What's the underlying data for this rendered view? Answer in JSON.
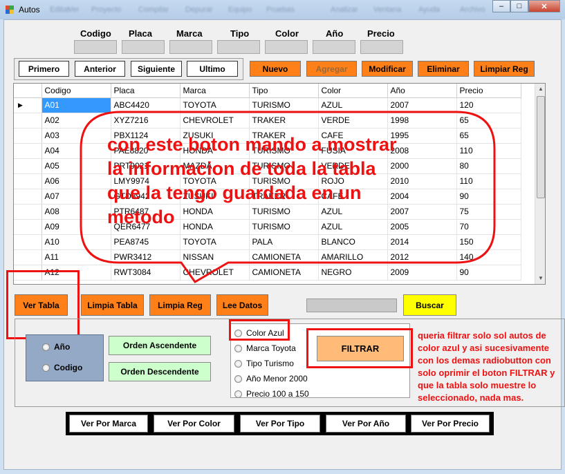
{
  "window": {
    "title": "Autos",
    "menu_blur": [
      "Archivo",
      "Editar",
      "Ver",
      "Proyecto",
      "Compilar",
      "Depurar",
      "Equipo",
      "Herramientas",
      "Pruebas",
      "Analizar",
      "Ventana",
      "Ayuda"
    ],
    "min": "–",
    "max": "□",
    "close": "✕"
  },
  "fields": {
    "headers": [
      "Codigo",
      "Placa",
      "Marca",
      "Tipo",
      "Color",
      "Año",
      "Precio"
    ]
  },
  "nav": {
    "first": "Primero",
    "prev": "Anterior",
    "next": "Siguiente",
    "last": "Ultimo"
  },
  "actions": {
    "nuevo": "Nuevo",
    "agregar": "Agregar",
    "modificar": "Modificar",
    "eliminar": "Eliminar",
    "limpiar": "Limpiar Reg"
  },
  "grid": {
    "columns": [
      "Codigo",
      "Placa",
      "Marca",
      "Tipo",
      "Color",
      "Año",
      "Precio"
    ],
    "rows": [
      [
        "A01",
        "ABC4420",
        "TOYOTA",
        "TURISMO",
        "AZUL",
        "2007",
        "120"
      ],
      [
        "A02",
        "XYZ7216",
        "CHEVROLET",
        "TRAKER",
        "VERDE",
        "1998",
        "65"
      ],
      [
        "A03",
        "PBX1124",
        "ZUSUKI",
        "TRAKER",
        "CAFE",
        "1995",
        "65"
      ],
      [
        "A04",
        "PAE8820",
        "HONDA",
        "TURISMO",
        "FUSIA",
        "2008",
        "110"
      ],
      [
        "A05",
        "PRT9021",
        "MAZDA",
        "TURISMO",
        "VERDE",
        "2000",
        "80"
      ],
      [
        "A06",
        "LMY9974",
        "TOYOTA",
        "TURISMO",
        "ROJO",
        "2010",
        "110"
      ],
      [
        "A07",
        "GTD8942",
        "ZUSUKI",
        "TRAKER",
        "CAFE",
        "2004",
        "90"
      ],
      [
        "A08",
        "PTR6487",
        "HONDA",
        "TURISMO",
        "AZUL",
        "2007",
        "75"
      ],
      [
        "A09",
        "QER6477",
        "HONDA",
        "TURISMO",
        "AZUL",
        "2005",
        "70"
      ],
      [
        "A10",
        "PEA8745",
        "TOYOTA",
        "PALA",
        "BLANCO",
        "2014",
        "150"
      ],
      [
        "A11",
        "PWR3412",
        "NISSAN",
        "CAMIONETA",
        "AMARILLO",
        "2012",
        "140"
      ],
      [
        "A12",
        "RWT3084",
        "CHEVROLET",
        "CAMIONETA",
        "NEGRO",
        "2009",
        "90"
      ]
    ]
  },
  "annotation": {
    "bubble_text": "con este boton mando a mostrar la informacion de toda la tabla que la tengo guardada en un metodo",
    "note_text": "queria filtrar solo sol autos de color azul y asi sucesivamente con los demas radiobutton con solo oprimir el boton FILTRAR y que la tabla solo muestre lo seleccionado, nada mas."
  },
  "mid_buttons": {
    "ver_tabla": "Ver Tabla",
    "limpia_tabla": "Limpia Tabla",
    "limpia_reg": "Limpia Reg",
    "lee_datos": "Lee Datos",
    "buscar": "Buscar"
  },
  "order": {
    "radio_ano": "Año",
    "radio_codigo": "Codigo",
    "asc": "Orden Ascendente",
    "desc": "Orden Descendente"
  },
  "filters": {
    "options": [
      "Color Azul",
      "Marca Toyota",
      "Tipo Turismo",
      "Año Menor 2000",
      "Precio 100 a 150"
    ],
    "filtrar": "FILTRAR"
  },
  "bottom": {
    "marca": "Ver Por Marca",
    "color": "Ver Por Color",
    "tipo": "Ver Por Tipo",
    "ano": "Ver Por Año",
    "precio": "Ver Por Precio"
  },
  "colors": {
    "orange": "#ff7f19",
    "red_annotation": "#ee1111",
    "selection": "#3399ff",
    "green_button": "#ccffcc",
    "yellow_button": "#ffff00"
  }
}
